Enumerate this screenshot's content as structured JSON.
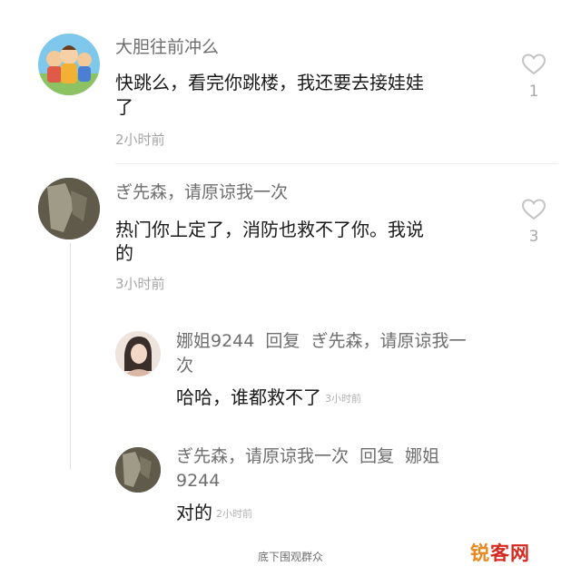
{
  "comments": [
    {
      "username": "大胆往前冲么",
      "text_line1": "快跳么，看完你跳楼，我还要去接娃娃",
      "text_line2": "了",
      "time": "2小时前",
      "likes": "1"
    },
    {
      "username": "ぎ先森，请原谅我一次",
      "text_line1": "热门你上定了，消防也救不了你。我说",
      "text_line2": "的",
      "time": "3小时前",
      "likes": "3",
      "replies": [
        {
          "header_line1": "娜姐9244  回复  ぎ先森，请原谅我一",
          "header_line2": "次",
          "text": "哈哈，谁都救不了",
          "time": "3小时前"
        },
        {
          "header_line1": "ぎ先森，请原谅我一次  回复  娜姐",
          "header_line2": "9244",
          "text": "对的",
          "time": "2小时前"
        }
      ]
    }
  ],
  "footer": "底下围观群众",
  "watermark": {
    "part1": "锐",
    "part2": "客",
    "part3": "网",
    "color1": "#e8871e",
    "color2": "#d42a1f"
  },
  "icons": {
    "like": "heart-outline-icon"
  }
}
